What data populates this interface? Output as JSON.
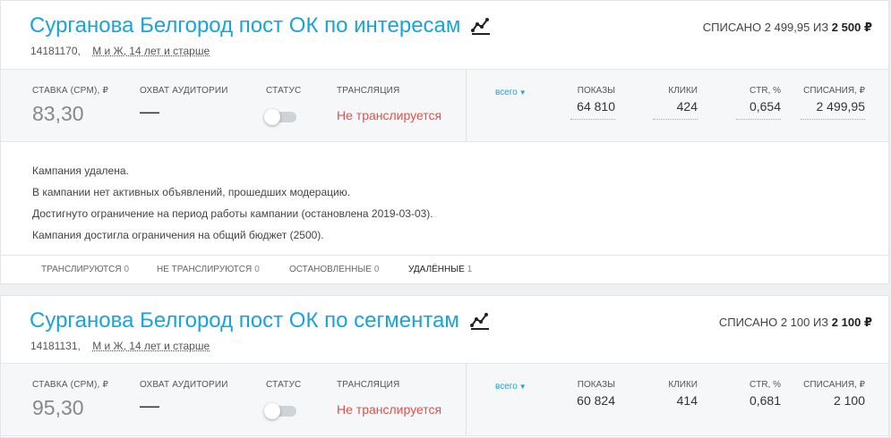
{
  "campaigns": [
    {
      "title": "Сурганова Белгород пост ОК по интересам",
      "id": "14181170,",
      "audience": "М и Ж, 14 лет и старше",
      "spent_prefix": "СПИСАНО 2 499,95 ИЗ",
      "spent_total": "2 500 ₽",
      "bid_label": "Ставка (CPM), ₽",
      "bid_value": "83,30",
      "reach_label": "Охват аудитории",
      "reach_value": "—",
      "status_label": "Статус",
      "broadcast_label": "Трансляция",
      "broadcast_value": "Не транслируется",
      "period_label": "всего",
      "impressions_label": "Показы",
      "impressions_value": "64 810",
      "clicks_label": "Клики",
      "clicks_value": "424",
      "ctr_label": "CTR, %",
      "ctr_value": "0,654",
      "spend_label": "Списания, ₽",
      "spend_value": "2 499,95",
      "notes": [
        "Кампания удалена.",
        "В кампании нет активных объявлений, прошедших модерацию.",
        "Достигнуто ограничение на период работы кампании (остановлена 2019-03-03).",
        "Кампания достигла ограничения на общий бюджет (2500)."
      ],
      "filters": [
        {
          "label": "Транслируются",
          "count": "0"
        },
        {
          "label": "Не транслируются",
          "count": "0"
        },
        {
          "label": "Остановленные",
          "count": "0"
        },
        {
          "label": "Удалённые",
          "count": "1"
        }
      ]
    },
    {
      "title": "Сурганова Белгород пост ОК по сегментам",
      "id": "14181131,",
      "audience": "М и Ж, 14 лет и старше",
      "spent_prefix": "СПИСАНО 2 100 ИЗ",
      "spent_total": "2 100 ₽",
      "bid_label": "Ставка (CPM), ₽",
      "bid_value": "95,30",
      "reach_label": "Охват аудитории",
      "reach_value": "—",
      "status_label": "Статус",
      "broadcast_label": "Трансляция",
      "broadcast_value": "Не транслируется",
      "period_label": "всего",
      "impressions_label": "Показы",
      "impressions_value": "60 824",
      "clicks_label": "Клики",
      "clicks_value": "414",
      "ctr_label": "CTR, %",
      "ctr_value": "0,681",
      "spend_label": "Списания, ₽",
      "spend_value": "2 100"
    }
  ],
  "icons": {
    "stats": "line-chart-icon",
    "caret": "caret-down-icon"
  },
  "colors": {
    "title": "#1aa3d9",
    "not_broadcasting": "#d9534f",
    "toggle_off": "#cfd2d6"
  }
}
